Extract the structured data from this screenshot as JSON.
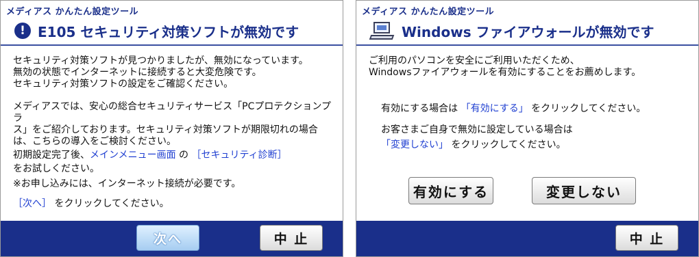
{
  "left": {
    "app_title": "メディアス かんたん設定ツール",
    "heading": "E105 セキュリティ対策ソフトが無効です",
    "icon": "exclamation-circle-icon",
    "paragraph1": [
      "セキュリティ対策ソフトが見つかりましたが、無効になっています。",
      "無効の状態でインターネットに接続すると大変危険です。",
      "セキュリティ対策ソフトの設定をご確認ください。"
    ],
    "paragraph2": [
      "メディアスでは、安心の総合セキュリティサービス「PCプロテクションプラ",
      "ス」をご紹介しております。セキュリティ対策ソフトが期限切れの場合",
      "は、こちらの導入をご検討ください。"
    ],
    "setup_line": {
      "prefix": "初期設定完了後、",
      "menu_link": "メインメニュー画面",
      "mid": " の ",
      "diag_link": "［セキュリティ診断］"
    },
    "try_line": "をお試しください。",
    "note": "※お申し込みには、インターネット接続が必要です。",
    "next_instruction": {
      "link": "［次へ］",
      "suffix": " をクリックしてください。"
    },
    "buttons": {
      "next": "次へ",
      "cancel": "中 止"
    }
  },
  "right": {
    "app_title": "メディアス かんたん設定ツール",
    "heading": "Windows ファイアウォールが無効です",
    "icon": "computer-icon",
    "intro": [
      "ご利用のパソコンを安全にご利用いただくため、",
      "Windowsファイアウォールを有効にすることをお薦めします。"
    ],
    "enable_line": {
      "prefix": "有効にする場合は ",
      "link": "「有効にする」",
      "suffix": " をクリックしてください。"
    },
    "disabled_line": "お客さまご自身で無効に設定している場合は",
    "keep_line": {
      "link": "「変更しない」",
      "suffix": " をクリックしてください。"
    },
    "buttons": {
      "enable": "有効にする",
      "keep": "変更しない",
      "cancel": "中 止"
    }
  },
  "colors": {
    "title_blue": "#1a2f8a",
    "link_blue": "#1f3fd1",
    "footer_blue": "#1a2f8a"
  }
}
